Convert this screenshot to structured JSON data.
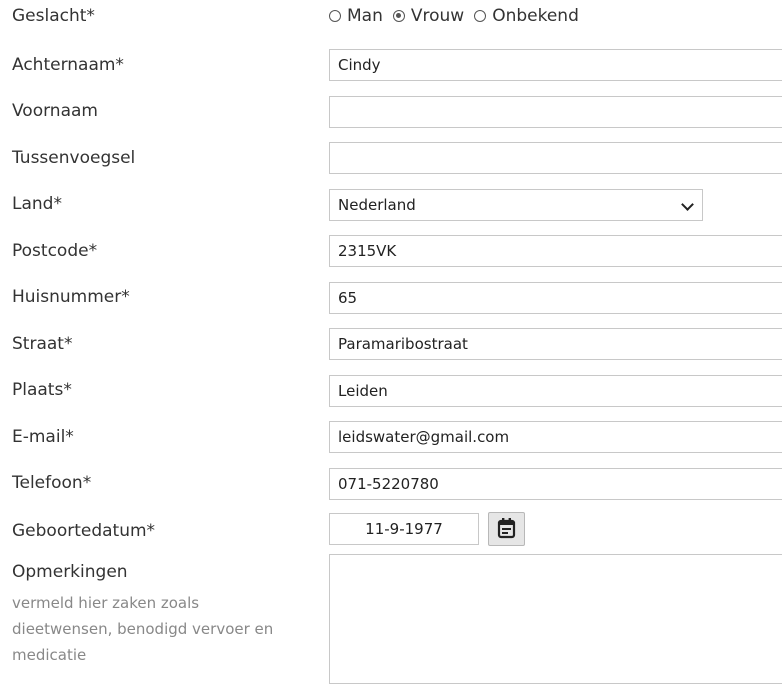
{
  "form": {
    "gender": {
      "label": "Geslacht*",
      "options": [
        {
          "label": "Man",
          "checked": false
        },
        {
          "label": "Vrouw",
          "checked": true
        },
        {
          "label": "Onbekend",
          "checked": false
        }
      ]
    },
    "lastname": {
      "label": "Achternaam*",
      "value": "Cindy"
    },
    "firstname": {
      "label": "Voornaam",
      "value": ""
    },
    "infix": {
      "label": "Tussenvoegsel",
      "value": ""
    },
    "country": {
      "label": "Land*",
      "value": "Nederland"
    },
    "postcode": {
      "label": "Postcode*",
      "value": "2315VK"
    },
    "housenumber": {
      "label": "Huisnummer*",
      "value": "65"
    },
    "street": {
      "label": "Straat*",
      "value": "Paramaribostraat"
    },
    "city": {
      "label": "Plaats*",
      "value": "Leiden"
    },
    "email": {
      "label": "E-mail*",
      "value": "leidswater@gmail.com"
    },
    "phone": {
      "label": "Telefoon*",
      "value": "071-5220780"
    },
    "birthdate": {
      "label": "Geboortedatum*",
      "value": "11-9-1977"
    },
    "remarks": {
      "label": "Opmerkingen",
      "hint_lines": [
        "vermeld hier zaken zoals",
        "dieetwensen, benodigd vervoer en",
        "medicatie"
      ],
      "value": ""
    }
  }
}
